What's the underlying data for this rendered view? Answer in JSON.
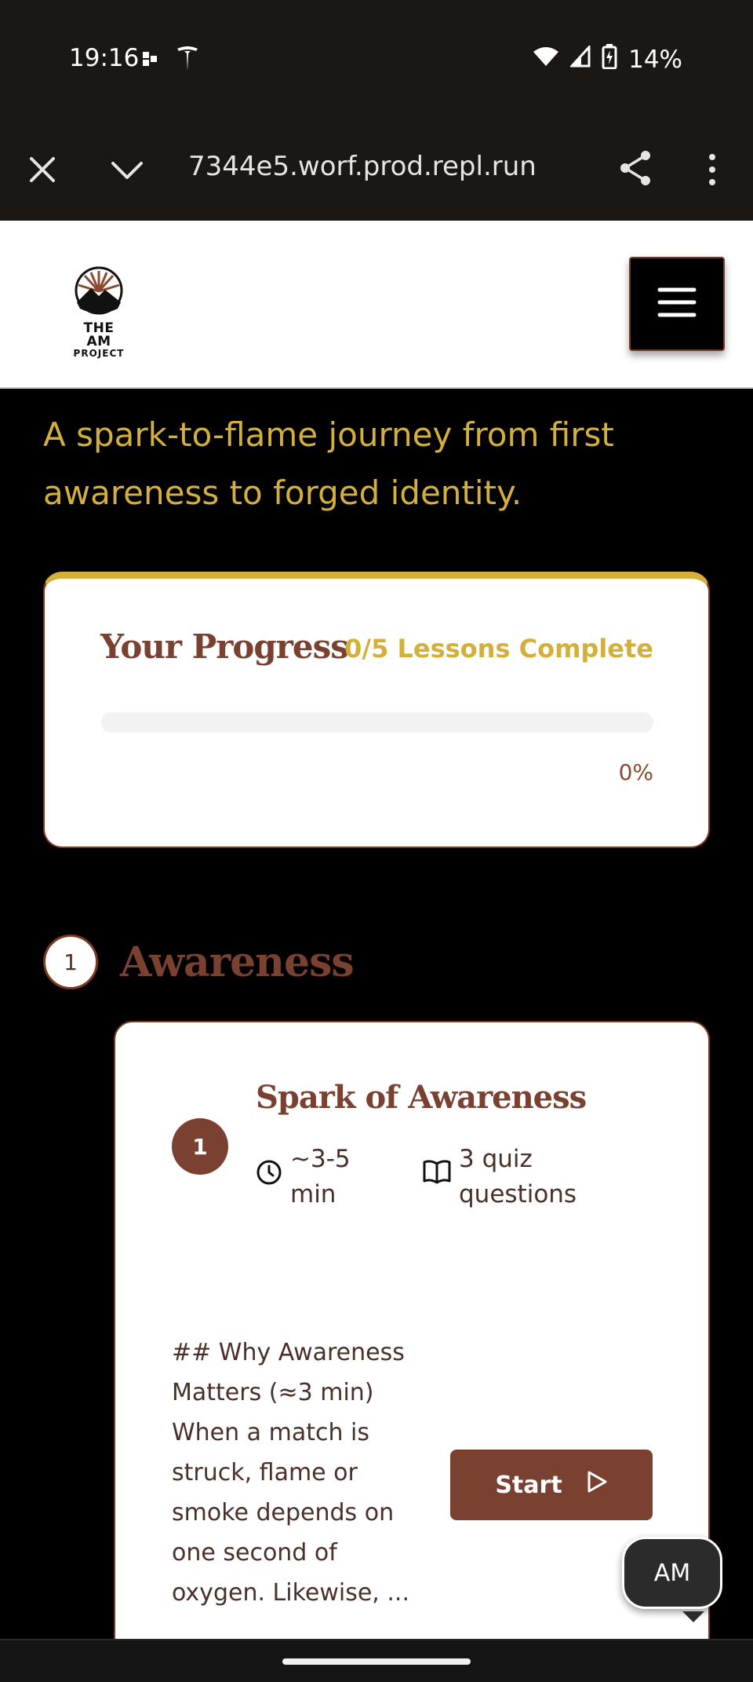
{
  "status_bar": {
    "time": "19:16",
    "battery": "14%",
    "icons": [
      "notification-dots-icon",
      "tesla-icon",
      "wifi-icon",
      "cell-signal-icon",
      "battery-icon"
    ]
  },
  "browser": {
    "url": "7344e5.worf.prod.repl.run",
    "icons": [
      "close-icon",
      "chevron-down-icon",
      "share-icon",
      "more-vertical-icon"
    ]
  },
  "header": {
    "logo_line1": "THE AM",
    "logo_line2": "PROJECT",
    "menu_icon": "hamburger-icon"
  },
  "main": {
    "subtitle": "A spark-to-flame journey from first awareness to forged identity."
  },
  "progress": {
    "title": "Your Progress",
    "count": "0/5 Lessons Complete",
    "percent_label": "0%",
    "fraction": 0
  },
  "section": {
    "number": "1",
    "title": "Awareness"
  },
  "lesson": {
    "number": "1",
    "title": "Spark of Awareness",
    "duration": "~3-5 min",
    "quiz": "3 quiz questions",
    "excerpt": "## Why Awareness Matters (≈3 min) When a match is struck, flame or smoke depends on one second of oxygen. Likewise, ...",
    "start_label": "Start"
  },
  "fab": {
    "label": "AM"
  },
  "colors": {
    "gold": "#d4af3a",
    "brown": "#7a4030",
    "background": "#000000"
  }
}
